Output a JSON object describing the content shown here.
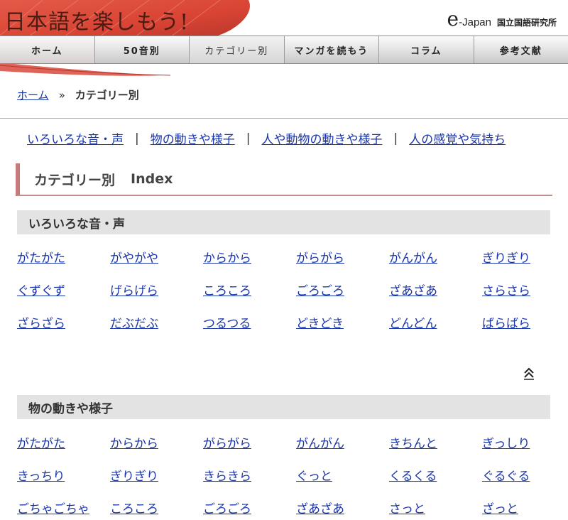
{
  "header": {
    "logo_text": "日本語を楽しもう!",
    "org_e": "e",
    "org_japan": "-Japan",
    "org_institute": "国立国語研究所"
  },
  "nav": [
    {
      "label": "ホーム",
      "name": "nav-home"
    },
    {
      "label": "50音別",
      "name": "nav-50on"
    },
    {
      "label": "カテゴリー別",
      "name": "nav-category"
    },
    {
      "label": "マンガを読もう",
      "name": "nav-manga"
    },
    {
      "label": "コラム",
      "name": "nav-column"
    },
    {
      "label": "参考文献",
      "name": "nav-references"
    }
  ],
  "breadcrumb": {
    "home": "ホーム",
    "sep": "»",
    "current": "カテゴリー別"
  },
  "category_links": [
    "いろいろな音・声",
    "物の動きや様子",
    "人や動物の動きや様子",
    "人の感覚や気持ち"
  ],
  "category_sep": "|",
  "index_heading": {
    "title": "カテゴリー別",
    "suffix": "Index"
  },
  "sections": [
    {
      "title": "いろいろな音・声",
      "words": [
        "がたがた",
        "がやがや",
        "からから",
        "がらがら",
        "がんがん",
        "ぎりぎり",
        "ぐずぐず",
        "げらげら",
        "ころころ",
        "ごろごろ",
        "ざあざあ",
        "さらさら",
        "ざらざら",
        "だぶだぶ",
        "つるつる",
        "どきどき",
        "どんどん",
        "ばらばら"
      ]
    },
    {
      "title": "物の動きや様子",
      "words": [
        "がたがた",
        "からから",
        "がらがら",
        "がんがん",
        "きちんと",
        "ぎっしり",
        "きっちり",
        "ぎりぎり",
        "きらきら",
        "ぐっと",
        "くるくる",
        "ぐるぐる",
        "ごちゃごちゃ",
        "ころころ",
        "ごろごろ",
        "ざあざあ",
        "さっと",
        "ざっと"
      ]
    }
  ],
  "icons": {
    "to_top": "double-chevron-up-icon"
  },
  "colors": {
    "link": "#1a35a8",
    "accent": "#c77a7a",
    "parasol": "#d9483b"
  }
}
